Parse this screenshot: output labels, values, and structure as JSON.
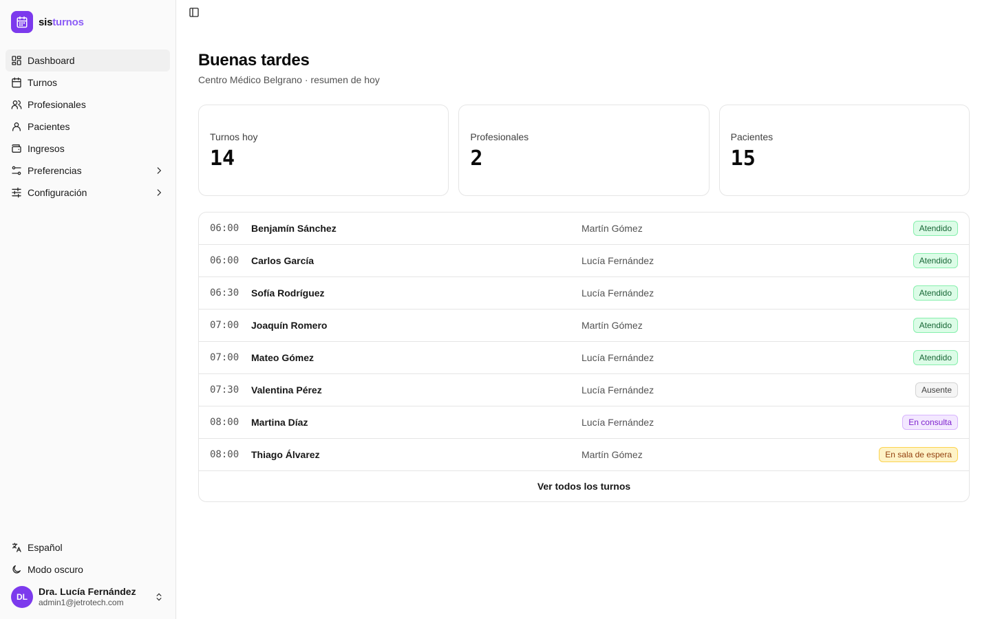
{
  "brand": {
    "name_part1": "sis",
    "name_part2": "turnos",
    "accent": "#7c3aed",
    "icon": "calendar-icon"
  },
  "sidebar": {
    "items": [
      {
        "label": "Dashboard",
        "icon": "dashboard-icon",
        "active": true
      },
      {
        "label": "Turnos",
        "icon": "calendar-icon"
      },
      {
        "label": "Profesionales",
        "icon": "users-icon"
      },
      {
        "label": "Pacientes",
        "icon": "user-icon"
      },
      {
        "label": "Ingresos",
        "icon": "wallet-icon"
      },
      {
        "label": "Preferencias",
        "icon": "sliders-icon",
        "has_submenu": true
      },
      {
        "label": "Configuración",
        "icon": "settings-sliders-icon",
        "has_submenu": true
      }
    ],
    "bottom": [
      {
        "label": "Español",
        "icon": "translate-icon"
      },
      {
        "label": "Modo oscuro",
        "icon": "moon-icon"
      }
    ],
    "user": {
      "initials": "DL",
      "name": "Dra. Lucía Fernández",
      "email": "admin1@jetrotech.com"
    }
  },
  "header": {
    "title": "Buenas tardes",
    "subtitle": "Centro Médico Belgrano · resumen de hoy"
  },
  "stats": [
    {
      "label": "Turnos hoy",
      "value": "14"
    },
    {
      "label": "Profesionales",
      "value": "2"
    },
    {
      "label": "Pacientes",
      "value": "15"
    }
  ],
  "appointments": [
    {
      "time": "06:00",
      "patient": "Benjamín Sánchez",
      "professional": "Martín Gómez",
      "status": "Atendido",
      "status_type": "green"
    },
    {
      "time": "06:00",
      "patient": "Carlos García",
      "professional": "Lucía Fernández",
      "status": "Atendido",
      "status_type": "green"
    },
    {
      "time": "06:30",
      "patient": "Sofía Rodríguez",
      "professional": "Lucía Fernández",
      "status": "Atendido",
      "status_type": "green"
    },
    {
      "time": "07:00",
      "patient": "Joaquín Romero",
      "professional": "Martín Gómez",
      "status": "Atendido",
      "status_type": "green"
    },
    {
      "time": "07:00",
      "patient": "Mateo Gómez",
      "professional": "Lucía Fernández",
      "status": "Atendido",
      "status_type": "green"
    },
    {
      "time": "07:30",
      "patient": "Valentina Pérez",
      "professional": "Lucía Fernández",
      "status": "Ausente",
      "status_type": "gray"
    },
    {
      "time": "08:00",
      "patient": "Martina Díaz",
      "professional": "Lucía Fernández",
      "status": "En consulta",
      "status_type": "purple"
    },
    {
      "time": "08:00",
      "patient": "Thiago Álvarez",
      "professional": "Martín Gómez",
      "status": "En sala de espera",
      "status_type": "amber"
    }
  ],
  "list_footer": "Ver todos los turnos"
}
